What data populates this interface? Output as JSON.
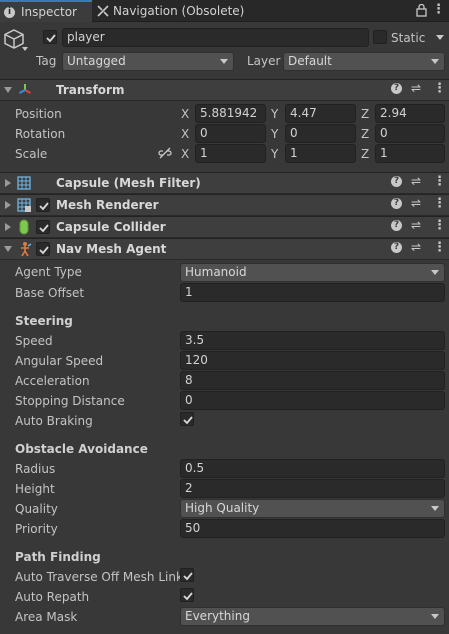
{
  "tabs": {
    "inspector": "Inspector",
    "navigation": "Navigation (Obsolete)"
  },
  "object": {
    "name": "player",
    "static_label": "Static",
    "tag_label": "Tag",
    "tag_value": "Untagged",
    "layer_label": "Layer",
    "layer_value": "Default"
  },
  "transform": {
    "title": "Transform",
    "position_label": "Position",
    "rotation_label": "Rotation",
    "scale_label": "Scale",
    "axes": {
      "x": "X",
      "y": "Y",
      "z": "Z"
    },
    "position": {
      "x": "5.881942",
      "y": "4.47",
      "z": "2.94"
    },
    "rotation": {
      "x": "0",
      "y": "0",
      "z": "0"
    },
    "scale": {
      "x": "1",
      "y": "1",
      "z": "1"
    }
  },
  "components": {
    "mesh_filter": "Capsule (Mesh Filter)",
    "mesh_renderer": "Mesh Renderer",
    "capsule_collider": "Capsule Collider",
    "nav_mesh_agent": "Nav Mesh Agent"
  },
  "agent": {
    "agent_type_label": "Agent Type",
    "agent_type_value": "Humanoid",
    "base_offset_label": "Base Offset",
    "base_offset_value": "1",
    "steering_header": "Steering",
    "speed_label": "Speed",
    "speed_value": "3.5",
    "angular_speed_label": "Angular Speed",
    "angular_speed_value": "120",
    "acceleration_label": "Acceleration",
    "acceleration_value": "8",
    "stopping_distance_label": "Stopping Distance",
    "stopping_distance_value": "0",
    "auto_braking_label": "Auto Braking",
    "obstacle_header": "Obstacle Avoidance",
    "radius_label": "Radius",
    "radius_value": "0.5",
    "height_label": "Height",
    "height_value": "2",
    "quality_label": "Quality",
    "quality_value": "High Quality",
    "priority_label": "Priority",
    "priority_value": "50",
    "path_header": "Path Finding",
    "auto_traverse_label": "Auto Traverse Off Mesh Link",
    "auto_repath_label": "Auto Repath",
    "area_mask_label": "Area Mask",
    "area_mask_value": "Everything"
  },
  "colors": {
    "panel_bg": "#383838",
    "header_bg": "#3e3e3e",
    "field_bg": "#2a2a2a",
    "dropdown_bg": "#515151",
    "active_tab_accent": "#3a79bb"
  }
}
